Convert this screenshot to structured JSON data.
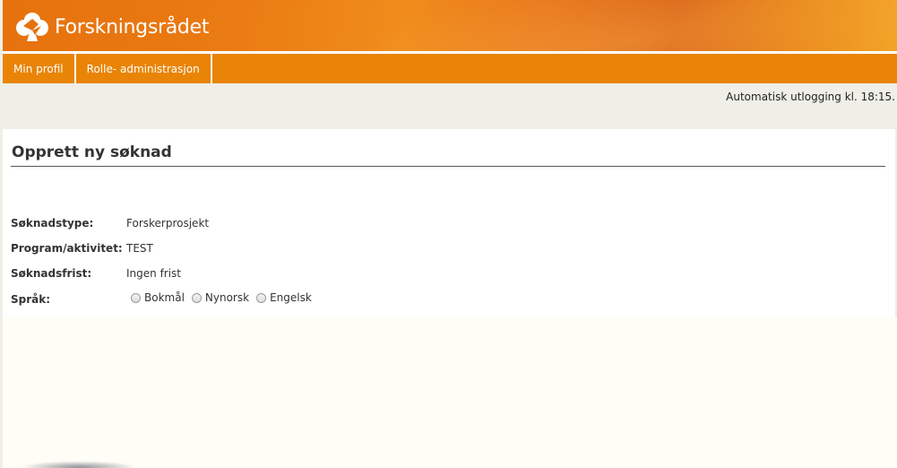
{
  "brand": {
    "name": "Forskningsrådet",
    "logo_icon": "forskningsradet-logo-icon"
  },
  "nav": {
    "items": [
      {
        "label": "Min profil"
      },
      {
        "label": "Rolle- administrasjon"
      }
    ]
  },
  "session": {
    "logout_notice": "Automatisk utlogging kl. 18:15."
  },
  "form": {
    "title": "Opprett ny søknad",
    "fields": [
      {
        "label": "Søknadstype:",
        "value": "Forskerprosjekt"
      },
      {
        "label": "Program/aktivitet:",
        "value": "TEST"
      },
      {
        "label": "Søknadsfrist:",
        "value": "Ingen frist"
      }
    ],
    "language": {
      "label": "Språk:",
      "options": [
        "Bokmål",
        "Nynorsk",
        "Engelsk"
      ],
      "selected": ""
    }
  },
  "colors": {
    "banner_orange": "#e6720e",
    "nav_orange": "#e98406",
    "page_background": "#efefe7"
  }
}
